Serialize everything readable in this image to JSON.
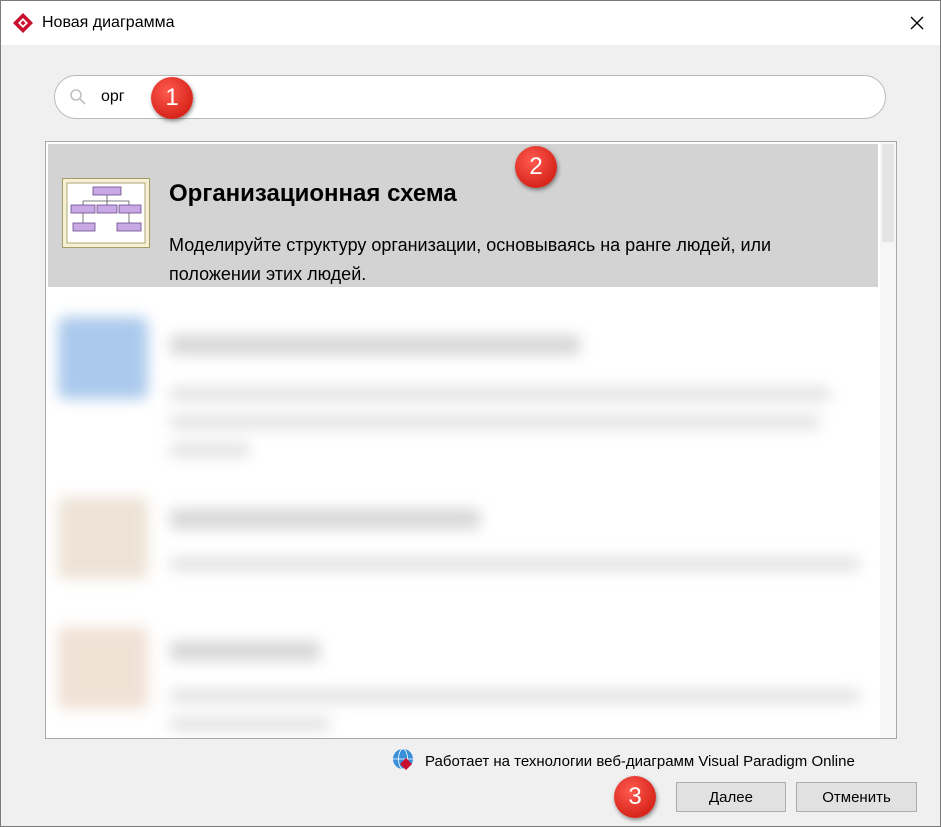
{
  "window": {
    "title": "Новая диаграмма",
    "close_symbol": "✕"
  },
  "search": {
    "value": "орг",
    "icon": "search-icon"
  },
  "badges": [
    "1",
    "2",
    "3"
  ],
  "results": {
    "selected_item": {
      "title": "Организационная схема",
      "description": "Моделируйте структуру организации, основываясь на ранге людей, или положении этих людей."
    }
  },
  "footer": {
    "powered_by": "Работает на технологии веб-диаграмм Visual Paradigm Online"
  },
  "buttons": {
    "next": "Далее",
    "cancel": "Отменить"
  },
  "colors": {
    "badge": "#e0322a",
    "selected_row": "#d3d3d3",
    "brand": "#c8102e"
  }
}
